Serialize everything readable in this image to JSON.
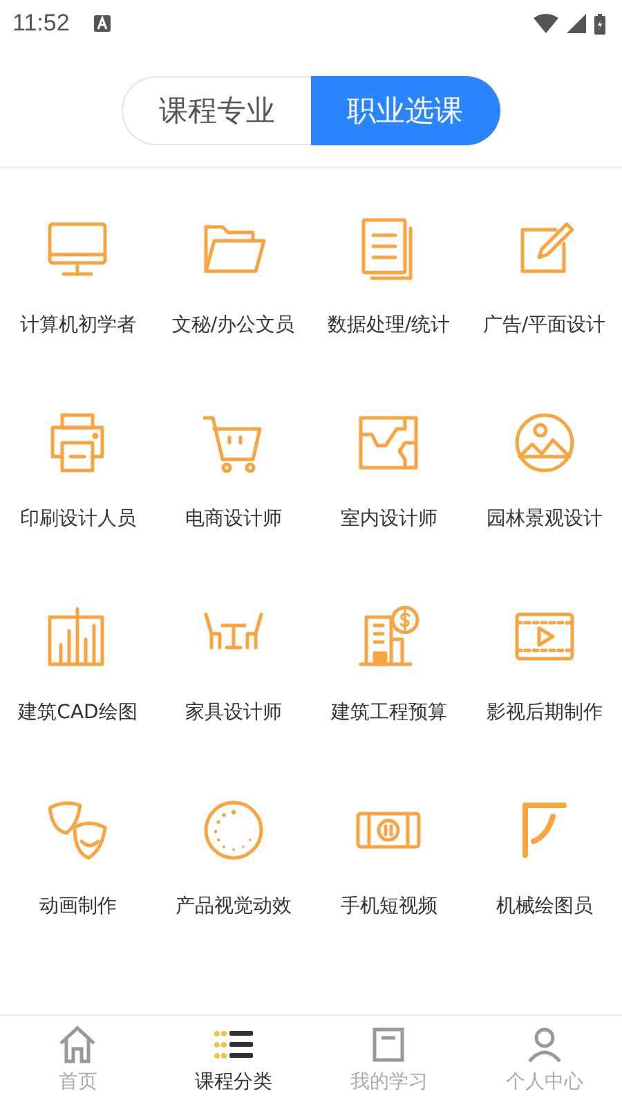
{
  "status_bar": {
    "time": "11:52"
  },
  "segments": [
    {
      "label": "课程专业",
      "selected": false
    },
    {
      "label": "职业选课",
      "selected": true
    }
  ],
  "categories": [
    {
      "label": "计算机初学者"
    },
    {
      "label": "文秘/办公文员"
    },
    {
      "label": "数据处理/统计"
    },
    {
      "label": "广告/平面设计"
    },
    {
      "label": "印刷设计人员"
    },
    {
      "label": "电商设计师"
    },
    {
      "label": "室内设计师"
    },
    {
      "label": "园林景观设计"
    },
    {
      "label": "建筑CAD绘图"
    },
    {
      "label": "家具设计师"
    },
    {
      "label": "建筑工程预算"
    },
    {
      "label": "影视后期制作"
    },
    {
      "label": "动画制作"
    },
    {
      "label": "产品视觉动效"
    },
    {
      "label": "手机短视频"
    },
    {
      "label": "机械绘图员"
    }
  ],
  "bottom_nav": [
    {
      "label": "首页",
      "selected": false
    },
    {
      "label": "课程分类",
      "selected": true
    },
    {
      "label": "我的学习",
      "selected": false
    },
    {
      "label": "个人中心",
      "selected": false
    }
  ]
}
